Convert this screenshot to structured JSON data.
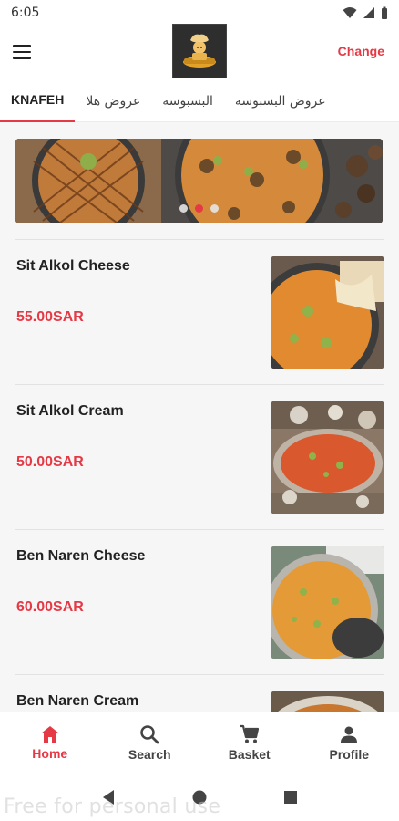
{
  "status_bar": {
    "time": "6:05"
  },
  "header": {
    "change_label": "Change"
  },
  "tabs": [
    {
      "label": "KNAFEH",
      "active": true
    },
    {
      "label": "عروض هلا",
      "active": false
    },
    {
      "label": "البسبوسة",
      "active": false
    },
    {
      "label": "عروض البسبوسة",
      "active": false
    }
  ],
  "banner": {
    "slide_count": 3,
    "active_slide": 2
  },
  "products": [
    {
      "name": "Sit Alkol Cheese",
      "price": "55.00SAR",
      "image": "knafeh-cheese-photo"
    },
    {
      "name": "Sit Alkol Cream",
      "price": "50.00SAR",
      "image": "knafeh-cream-photo"
    },
    {
      "name": "Ben Naren Cheese",
      "price": "60.00SAR",
      "image": "knafeh-cheese-plate-photo"
    },
    {
      "name": "Ben Naren Cream",
      "price": "",
      "image": "knafeh-cream-tray-photo"
    }
  ],
  "bottom_nav": [
    {
      "label": "Home",
      "icon": "home-icon",
      "active": true
    },
    {
      "label": "Search",
      "icon": "search-icon",
      "active": false
    },
    {
      "label": "Basket",
      "icon": "cart-icon",
      "active": false
    },
    {
      "label": "Profile",
      "icon": "person-icon",
      "active": false
    }
  ],
  "watermark": "Free for personal use",
  "colors": {
    "accent": "#e53945",
    "background": "#f6f6f6"
  }
}
